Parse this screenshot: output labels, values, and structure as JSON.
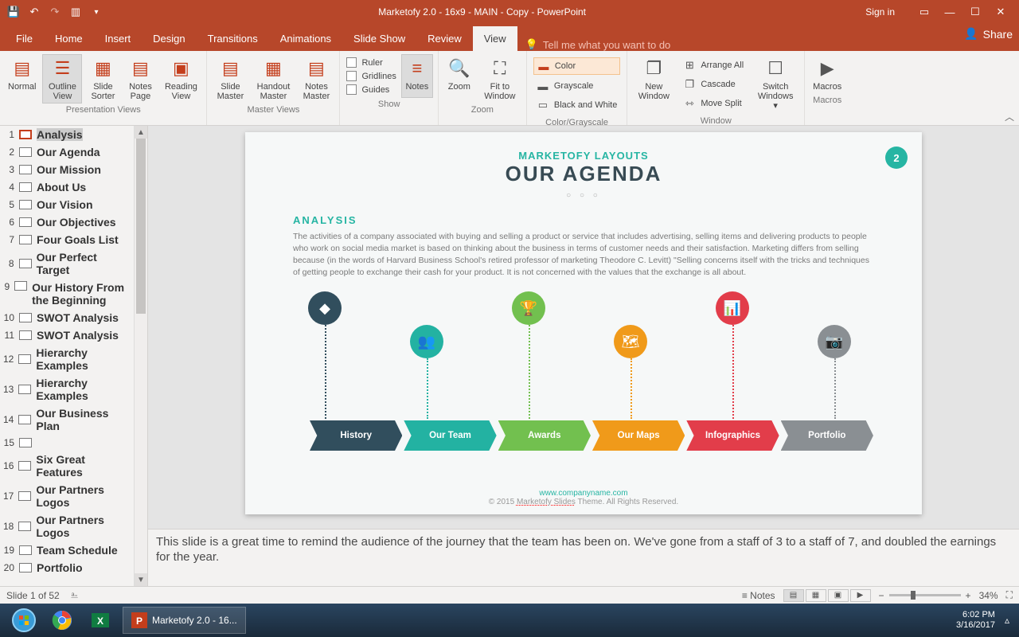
{
  "app": {
    "title": "Marketofy 2.0 - 16x9 - MAIN - Copy - PowerPoint",
    "signin": "Sign in",
    "tellme": "Tell me what you want to do",
    "share": "Share"
  },
  "tabs": [
    "File",
    "Home",
    "Insert",
    "Design",
    "Transitions",
    "Animations",
    "Slide Show",
    "Review",
    "View"
  ],
  "active_tab": "View",
  "ribbon": {
    "pres_views": {
      "label": "Presentation Views",
      "items": [
        "Normal",
        "Outline View",
        "Slide Sorter",
        "Notes Page",
        "Reading View"
      ]
    },
    "master_views": {
      "label": "Master Views",
      "items": [
        "Slide Master",
        "Handout Master",
        "Notes Master"
      ]
    },
    "show": {
      "label": "Show",
      "items": [
        "Ruler",
        "Gridlines",
        "Guides"
      ],
      "notes": "Notes"
    },
    "zoom": {
      "label": "Zoom",
      "zoom": "Zoom",
      "fit": "Fit to Window"
    },
    "color": {
      "label": "Color/Grayscale",
      "color": "Color",
      "gray": "Grayscale",
      "bw": "Black and White"
    },
    "window": {
      "label": "Window",
      "new": "New Window",
      "arrange": "Arrange All",
      "cascade": "Cascade",
      "split": "Move Split",
      "switch": "Switch Windows"
    },
    "macros": {
      "label": "Macros",
      "macros": "Macros"
    }
  },
  "outline": [
    {
      "n": 1,
      "t": "Analysis",
      "sel": true
    },
    {
      "n": 2,
      "t": "Our Agenda"
    },
    {
      "n": 3,
      "t": "Our Mission"
    },
    {
      "n": 4,
      "t": "About Us"
    },
    {
      "n": 5,
      "t": "Our Vision"
    },
    {
      "n": 6,
      "t": "Our Objectives"
    },
    {
      "n": 7,
      "t": "Four Goals List"
    },
    {
      "n": 8,
      "t": "Our Perfect Target"
    },
    {
      "n": 9,
      "t": "Our History From the Beginning"
    },
    {
      "n": 10,
      "t": "SWOT Analysis"
    },
    {
      "n": 11,
      "t": "SWOT Analysis"
    },
    {
      "n": 12,
      "t": "Hierarchy Examples"
    },
    {
      "n": 13,
      "t": "Hierarchy Examples"
    },
    {
      "n": 14,
      "t": "Our Business Plan"
    },
    {
      "n": 15,
      "t": ""
    },
    {
      "n": 16,
      "t": "Six Great Features"
    },
    {
      "n": 17,
      "t": "Our Partners Logos"
    },
    {
      "n": 18,
      "t": "Our Partners Logos"
    },
    {
      "n": 19,
      "t": "Team Schedule"
    },
    {
      "n": 20,
      "t": "Portfolio"
    }
  ],
  "slide": {
    "subtitle": "MARKETOFY LAYOUTS",
    "title": "OUR AGENDA",
    "section": "ANALYSIS",
    "body": "The activities of a company associated with buying and selling a product or service that includes advertising, selling items and delivering products to people who work on social media market is based on thinking about the business in terms of customer needs and their satisfaction. Marketing differs from selling because (in the words of Harvard Business School's retired professor of marketing Theodore C. Levitt) \"Selling concerns itself with the tricks and techniques of getting people to exchange their cash for your product. It is not concerned with the values that the exchange is all about.",
    "badge": "2",
    "steps": [
      {
        "label": "History",
        "color": "#314e5d",
        "circle": "#314e5d"
      },
      {
        "label": "Our Team",
        "color": "#23b2a2",
        "circle": "#23b2a2"
      },
      {
        "label": "Awards",
        "color": "#72c04f",
        "circle": "#72c04f"
      },
      {
        "label": "Our Maps",
        "color": "#f09a1a",
        "circle": "#f09a1a"
      },
      {
        "label": "Infographics",
        "color": "#e23d4a",
        "circle": "#e23d4a"
      },
      {
        "label": "Portfolio",
        "color": "#8a8f93",
        "circle": "#8a8f93"
      }
    ],
    "url": "www.companyname.com",
    "copyright": "© 2015 Marketofy Slides Theme. All Rights Reserved."
  },
  "notes": "This slide is a great time to remind the audience of the journey that the team has been on. We've gone from a staff of 3 to a staff of 7, and doubled the earnings for the year.",
  "status": {
    "left": "Slide 1 of 52",
    "notes": "Notes",
    "zoom": "34%"
  },
  "taskbar": {
    "app": "Marketofy 2.0 - 16...",
    "time": "6:02 PM",
    "date": "3/16/2017"
  }
}
